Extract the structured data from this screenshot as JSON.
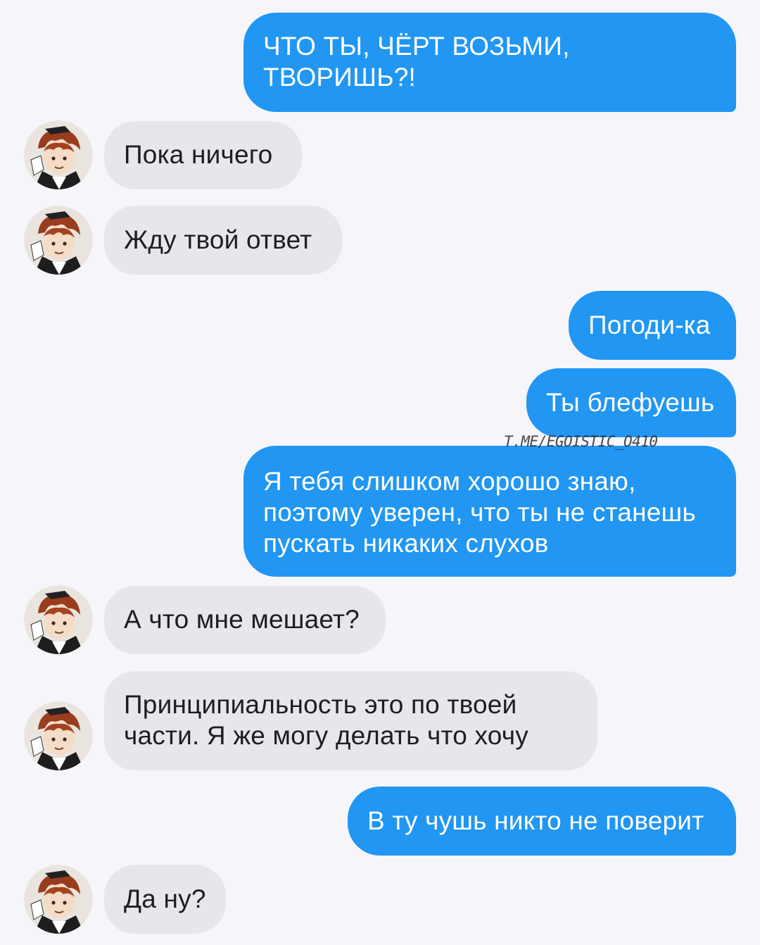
{
  "messages": [
    {
      "dir": "out",
      "lines": [
        "ЧТО ТЫ, ЧЁРТ ВОЗЬМИ,",
        "ТВОРИШЬ?!"
      ]
    },
    {
      "dir": "in",
      "lines": [
        "Пока ничего"
      ]
    },
    {
      "dir": "in",
      "lines": [
        "Жду твой ответ"
      ]
    },
    {
      "dir": "out",
      "lines": [
        "Погоди-ка"
      ]
    },
    {
      "dir": "out",
      "lines": [
        "Ты блефуешь"
      ]
    },
    {
      "dir": "out",
      "lines": [
        "Я тебя слишком хорошо знаю,",
        "поэтому уверен, что ты не станешь",
        "пускать никаких слухов"
      ]
    },
    {
      "dir": "in",
      "lines": [
        "А что мне мешает?"
      ]
    },
    {
      "dir": "in",
      "lines": [
        "Принципиальность это по твоей",
        "части. Я же могу делать что хочу"
      ]
    },
    {
      "dir": "out",
      "lines": [
        "В ту чушь никто не поверит"
      ]
    },
    {
      "dir": "in",
      "lines": [
        "Да ну?"
      ]
    }
  ],
  "watermark": "T.ME/EGOISTIC_O410",
  "colors": {
    "background": "#f6f6fa",
    "outgoing_bubble": "#2196f3",
    "incoming_bubble": "#e6e7ec"
  },
  "icons": {
    "avatar": "contact-avatar"
  }
}
